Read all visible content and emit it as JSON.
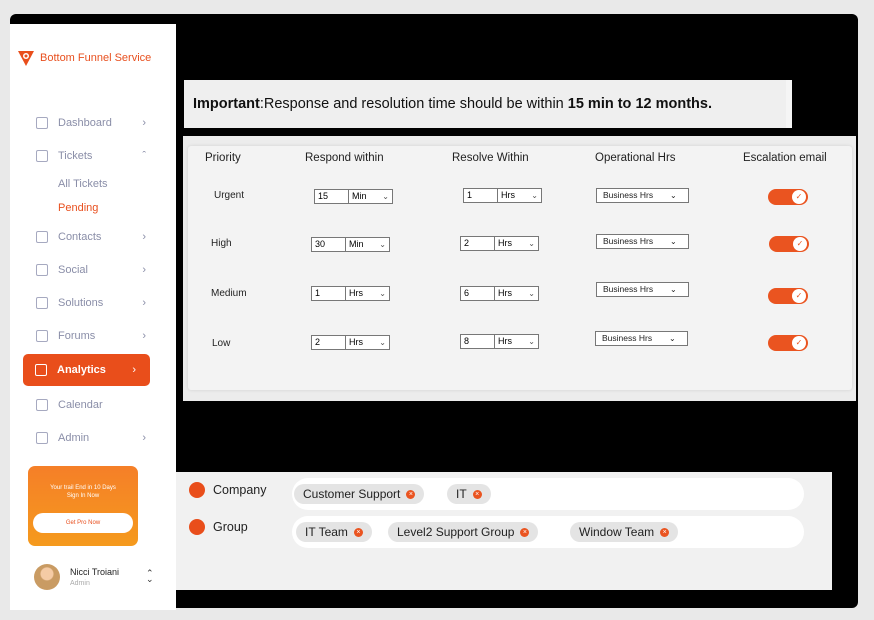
{
  "brand": {
    "name": "Bottom Funnel Service"
  },
  "sidebar": {
    "items": [
      {
        "label": "Dashboard",
        "icon": "dashboard-icon",
        "chevron": "›"
      },
      {
        "label": "Tickets",
        "icon": "tickets-icon",
        "chevron": "ˆ"
      },
      {
        "label": "Contacts",
        "icon": "contacts-icon",
        "chevron": "›"
      },
      {
        "label": "Social",
        "icon": "social-icon",
        "chevron": "›"
      },
      {
        "label": "Solutions",
        "icon": "solutions-icon",
        "chevron": "›"
      },
      {
        "label": "Forums",
        "icon": "forums-icon",
        "chevron": "›"
      },
      {
        "label": "Analytics",
        "icon": "analytics-icon",
        "chevron": "›"
      },
      {
        "label": "Calendar",
        "icon": "calendar-icon",
        "chevron": ""
      },
      {
        "label": "Admin",
        "icon": "admin-icon",
        "chevron": "›"
      }
    ],
    "sub_items": [
      {
        "label": "All Tickets"
      },
      {
        "label": "Pending"
      }
    ],
    "active_item": "Analytics",
    "active_sub_item": "Pending"
  },
  "promo": {
    "line1": "Your trail End in 10 Days",
    "line2": "Sign In Now",
    "button": "Get Pro Now"
  },
  "user": {
    "name": "Nicci Troiani",
    "role": "Admin"
  },
  "banner": {
    "bold_prefix": "Important",
    "text": ":Response and resolution time should be within ",
    "bold_suffix": "15 min to 12 months."
  },
  "table": {
    "headers": [
      "Priority",
      "Respond within",
      "Resolve Within",
      "Operational Hrs",
      "Escalation email"
    ],
    "rows": [
      {
        "priority": "Urgent",
        "respond_value": "15",
        "respond_unit": "Min",
        "resolve_value": "1",
        "resolve_unit": "Hrs",
        "operational": "Business Hrs",
        "escalation": true
      },
      {
        "priority": "High",
        "respond_value": "30",
        "respond_unit": "Min",
        "resolve_value": "2",
        "resolve_unit": "Hrs",
        "operational": "Business Hrs",
        "escalation": true
      },
      {
        "priority": "Medium",
        "respond_value": "1",
        "respond_unit": "Hrs",
        "resolve_value": "6",
        "resolve_unit": "Hrs",
        "operational": "Business Hrs",
        "escalation": true
      },
      {
        "priority": "Low",
        "respond_value": "2",
        "respond_unit": "Hrs",
        "resolve_value": "8",
        "resolve_unit": "Hrs",
        "operational": "Business Hrs",
        "escalation": true
      }
    ]
  },
  "assignments": {
    "company": {
      "label": "Company",
      "tags": [
        "Customer Support",
        "IT"
      ]
    },
    "group": {
      "label": "Group",
      "tags": [
        "IT Team",
        "Level2 Support Group",
        "Window Team"
      ]
    }
  },
  "colors": {
    "accent": "#e94e1b",
    "promo_start": "#f57f28",
    "promo_end": "#f59a1d"
  }
}
